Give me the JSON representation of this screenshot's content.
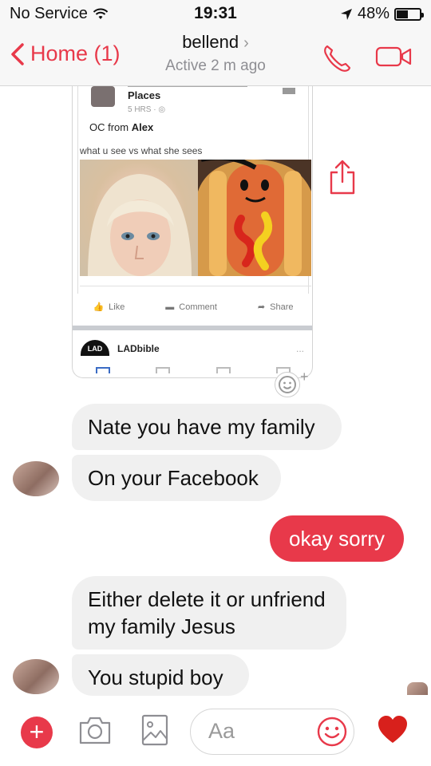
{
  "status_bar": {
    "carrier": "No Service",
    "time": "19:31",
    "battery_text": "48%",
    "battery_level": 0.48
  },
  "header": {
    "back_label": "Home (1)",
    "contact_name": "bellend",
    "status": "Active 2 m ago"
  },
  "shared_post": {
    "page_name": "Places",
    "time": "5 HRS · ",
    "description_prefix": "OC from ",
    "description_name": "Alex",
    "caption": "what u see vs what she sees",
    "actions": [
      "Like",
      "Comment",
      "Share"
    ],
    "second_page_name": "LADbible",
    "second_page_logo_text": "LAD",
    "dots": "..."
  },
  "messages": [
    {
      "text": "Nate you have my family",
      "direction": "incoming"
    },
    {
      "text": "On your Facebook",
      "direction": "incoming"
    },
    {
      "text": "okay sorry",
      "direction": "outgoing"
    },
    {
      "text": "Either delete it or unfriend my family Jesus",
      "direction": "incoming"
    },
    {
      "text": "You stupid boy",
      "direction": "incoming"
    }
  ],
  "composer": {
    "placeholder": "Aa"
  },
  "colors": {
    "accent": "#e8394a",
    "bubble_incoming": "#f0f0f0",
    "header_bg": "#f7f7f7"
  },
  "icons": {
    "back": "chevron-left-icon",
    "call": "phone-icon",
    "video": "video-camera-icon",
    "share": "share-icon",
    "react": "add-reaction-icon",
    "plus": "plus-icon",
    "camera": "camera-icon",
    "gallery": "image-icon",
    "emoji": "smiley-icon",
    "heart": "heart-icon"
  }
}
